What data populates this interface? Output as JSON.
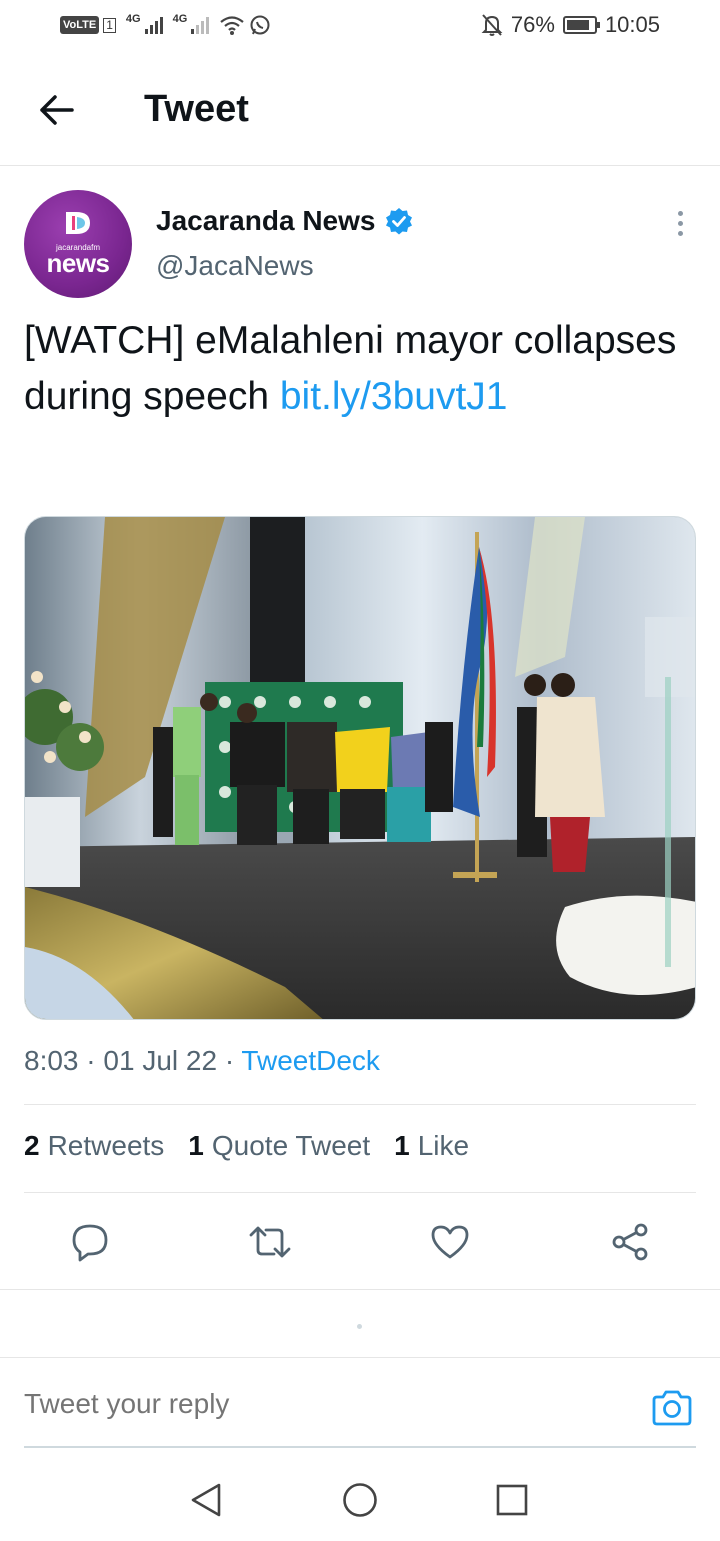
{
  "status_bar": {
    "volte": "VoLTE",
    "sim": "1",
    "network_1": "4G",
    "network_2": "4G",
    "battery_percent": "76%",
    "time": "10:05",
    "icons": [
      "signal-icon",
      "wifi-icon",
      "whatsapp-icon",
      "mute-icon",
      "battery-icon"
    ]
  },
  "header": {
    "title": "Tweet",
    "back_icon": "back-arrow-icon"
  },
  "tweet": {
    "avatar": {
      "small_text": "jacarandafm",
      "word": "news"
    },
    "author_name": "Jacaranda News",
    "verified_icon": "verified-badge-icon",
    "handle": "@JacaNews",
    "text": "[WATCH] eMalahleni mayor collapses during speech",
    "link": "bit.ly/3buvtJ1",
    "time": "8:03",
    "date": "01 Jul 22",
    "source": "TweetDeck",
    "retweets_count": "2",
    "retweets_label": "Retweets",
    "quotes_count": "1",
    "quotes_label": "Quote Tweet",
    "likes_count": "1",
    "likes_label": "Like"
  },
  "actions": [
    "reply-icon",
    "retweet-icon",
    "like-icon",
    "share-icon"
  ],
  "reply": {
    "placeholder": "Tweet your reply",
    "camera_icon": "camera-icon"
  },
  "colors": {
    "link": "#1d9bf0",
    "secondary_text": "#536471",
    "avatar_purple": "#7a2690"
  }
}
